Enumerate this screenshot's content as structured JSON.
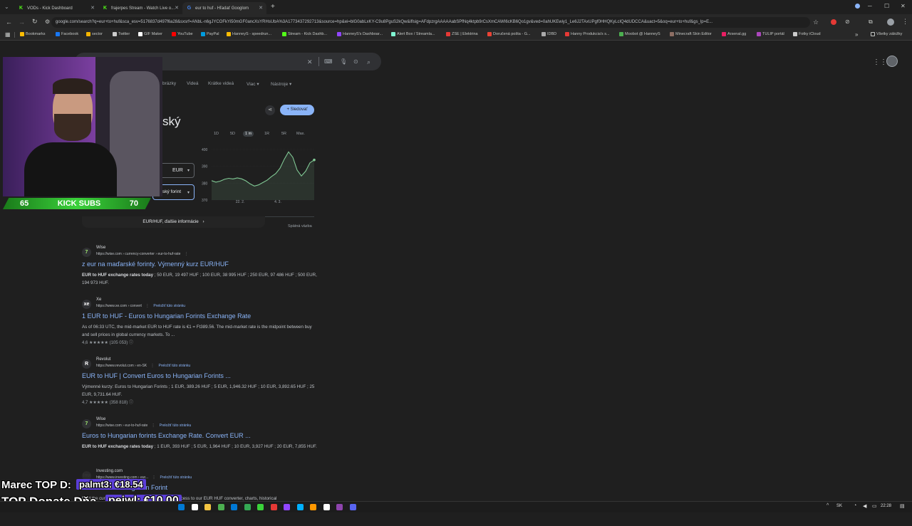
{
  "tabs": [
    {
      "label": "VODs - Kick Dashboard",
      "active": false
    },
    {
      "label": "frajerpes Stream - Watch Live o...",
      "active": false
    },
    {
      "label": "eur to huf - Hľadať Googlom",
      "active": true
    }
  ],
  "address_bar": {
    "url": "google.com/search?q=eur+to+huf&sca_esv=5176837d497f6a28&sxsrf=ANbL-n6gJYCOFkYi50mGF0ancXsYRHsUbA%3A1773437292713&source=hp&ei=blG0abLxKY-C9u8PguS2kQw&iflsig=AFdpzrgAAAAAabSPfNq4ktpb9rCsXmCAWI6cKB6Qo1gv&ved=0ahUKEwiy1_Le6J2TAxUPgf0HHQKyLcIQ4dUDCCA&uact=5&oq=eur+to+huf&gs_lp=E..."
  },
  "bookmarks": [
    {
      "label": "Bookmarks",
      "color": "#fbbc04"
    },
    {
      "label": "Facebook",
      "color": "#1877f2"
    },
    {
      "label": "sector",
      "color": "#f4b400"
    },
    {
      "label": "Twitter",
      "color": "#cccccc"
    },
    {
      "label": "GIF Maker",
      "color": "#ffffff"
    },
    {
      "label": "YouTube",
      "color": "#ff0000"
    },
    {
      "label": "PayPal",
      "color": "#009cde"
    },
    {
      "label": "HanneyS - speedrun...",
      "color": "#fbbc04"
    },
    {
      "label": "Stream - Kick Dashb...",
      "color": "#53fc18"
    },
    {
      "label": "HanneyS's Dashboar...",
      "color": "#9146ff"
    },
    {
      "label": "Alert Box / Streamla...",
      "color": "#80f5d2"
    },
    {
      "label": "ZSE | Elektrina",
      "color": "#e53935"
    },
    {
      "label": "Doručená pošta - G...",
      "color": "#ea4335"
    },
    {
      "label": "IDBD",
      "color": "#aaaaaa"
    },
    {
      "label": "Hanny Produkcia's s...",
      "color": "#e53935"
    },
    {
      "label": "Moobot @ HanneyS",
      "color": "#4caf50"
    },
    {
      "label": "Minecraft Skin Editor",
      "color": "#8d6e63"
    },
    {
      "label": "Arsenal.gg",
      "color": "#e91e63"
    },
    {
      "label": "TULIP portál",
      "color": "#ab47bc"
    },
    {
      "label": "Fotky iCloud",
      "color": "#cccccc"
    }
  ],
  "bookmarks_all": "Všetky záložky",
  "search": {
    "filters": [
      "brázky",
      "Videá",
      "Krátke videá",
      "Viac",
      "Nástroje"
    ],
    "follow_button": "Sledovať",
    "title_fragment": "ský",
    "currency_from": "EUR",
    "currency_to": "ský forint",
    "more_info": "EUR/HUF, ďalšie informácie",
    "feedback": "Spätná väzba"
  },
  "chart_data": {
    "type": "line",
    "ranges": [
      "1D",
      "5D",
      "1 m",
      "1R",
      "5R",
      "Max."
    ],
    "selected_range": "1 m",
    "y_ticks": [
      400,
      390,
      380,
      370
    ],
    "ylim": [
      370,
      400
    ],
    "x_ticks": [
      "22. 2.",
      "4. 3."
    ],
    "values": [
      381.5,
      380.6,
      381.2,
      382.3,
      382.9,
      382.5,
      383.1,
      382.6,
      381.4,
      379.6,
      378.3,
      379.0,
      380.4,
      381.8,
      383.9,
      385.7,
      388.9,
      394.2,
      398.6,
      395.3,
      387.8,
      384.3,
      387.1,
      392.1,
      393.8
    ]
  },
  "results": [
    {
      "site": "Wise",
      "url": "https://wise.com › currency-converter › eur-to-huf-rate",
      "translate": "",
      "title": "z eur na maďarské forinty. Výmenný kurz EUR/HUF",
      "snippet_bold": "EUR to HUF exchange rates today",
      "snippet": " ; 50 EUR, 19 497 HUF ; 100 EUR, 38 995 HUF ; 250 EUR, 97 486 HUF ; 500 EUR, 194 973 HUF.",
      "rating": "",
      "icon": "7",
      "icon_color": "#9fe870"
    },
    {
      "site": "Xe",
      "url": "https://www.xe.com › convert",
      "translate": "Preložiť túto stránku",
      "title": "1 EUR to HUF - Euros to Hungarian Forints Exchange Rate",
      "snippet_bold": "",
      "snippet": "As of 06:33 UTC, the mid-market EUR to HUF rate is €1 = Ft389.56. The mid-market rate is the midpoint between buy and sell prices in global currency markets. To ...",
      "rating": "4,6 ★★★★★ (105 053)",
      "icon": "xe",
      "icon_color": "#ffffff"
    },
    {
      "site": "Revolut",
      "url": "https://www.revolut.com › en-SK",
      "translate": "Preložiť túto stránku",
      "title": "EUR to HUF | Convert Euros to Hungarian Forints ...",
      "snippet_bold": "",
      "snippet": "Výmenné kurzy: Euros to Hungarian Forints ; 1 EUR, 389.26 HUF ; 5 EUR, 1,946.32 HUF ; 10 EUR, 3,892.65 HUF ; 25 EUR, 9,731.64 HUF.",
      "rating": "4,7 ★★★★★ (358 818)",
      "icon": "R",
      "icon_color": "#ffffff"
    },
    {
      "site": "Wise",
      "url": "https://wise.com › eur-to-huf-rate",
      "translate": "Preložiť túto stránku",
      "title": "Euros to Hungarian forints Exchange Rate. Convert EUR ...",
      "snippet_bold": "EUR to HUF exchange rates today",
      "snippet": " ; 1 EUR, 393 HUF ; 5 EUR, 1,964 HUF ; 10 EUR, 3,927 HUF ; 20 EUR, 7,855 HUF.",
      "rating": "",
      "icon": "7",
      "icon_color": "#9fe870"
    },
    {
      "site": "Investing.com",
      "url": "https://www.investing.com › eur...",
      "translate": "Preložiť túto stránku",
      "title": "EUR to Euro Hungarian Forint",
      "snippet_bold": "",
      "snippet": "Find the current Euro Hungarian Forint rate and access to our EUR HUF converter, charts, historical",
      "rating": "",
      "icon": "Inv",
      "icon_color": "#333333"
    }
  ],
  "overlay": {
    "subs_left": "65",
    "subs_label": "KICK SUBS",
    "subs_right": "70",
    "top_donor_label": "Marec TOP D:",
    "top_donor_value": "palmt3: €18.54",
    "top_donate_label": "TOP Donate Dňa -",
    "top_donate_value": "pejwl: €10.00"
  },
  "taskbar": {
    "lang": "SK",
    "time": "22:28"
  }
}
